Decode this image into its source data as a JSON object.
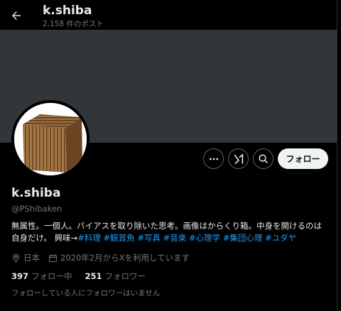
{
  "header": {
    "title": "k.shiba",
    "post_count": "2,158 件のポスト"
  },
  "actions": {
    "more_icon": "more-icon",
    "grok_icon": "grok-icon",
    "search_icon": "search-icon",
    "follow_label": "フォロー"
  },
  "profile": {
    "name": "k.shiba",
    "handle": "@PShibaken",
    "bio_text": "無属性。一個人。バイアスを取り除いた思考。画像はからくり箱。中身を開けるのは自身だけ。 興味→",
    "tags": [
      "#料理",
      "#観賞魚",
      "#写真",
      "#音楽",
      "#心理学",
      "#集団心理",
      "#ユダヤ"
    ],
    "location": "日本",
    "joined": "2020年2月からXを利用しています"
  },
  "stats": {
    "following_count": "397",
    "following_label": "フォロー中",
    "followers_count": "251",
    "followers_label": "フォロワー"
  },
  "note": "フォローしている人にフォロワーはいません",
  "colors": {
    "background": "#000000",
    "banner": "#333639",
    "accent": "#1d9bf0",
    "muted": "#71767b",
    "text": "#e7e9ea"
  }
}
